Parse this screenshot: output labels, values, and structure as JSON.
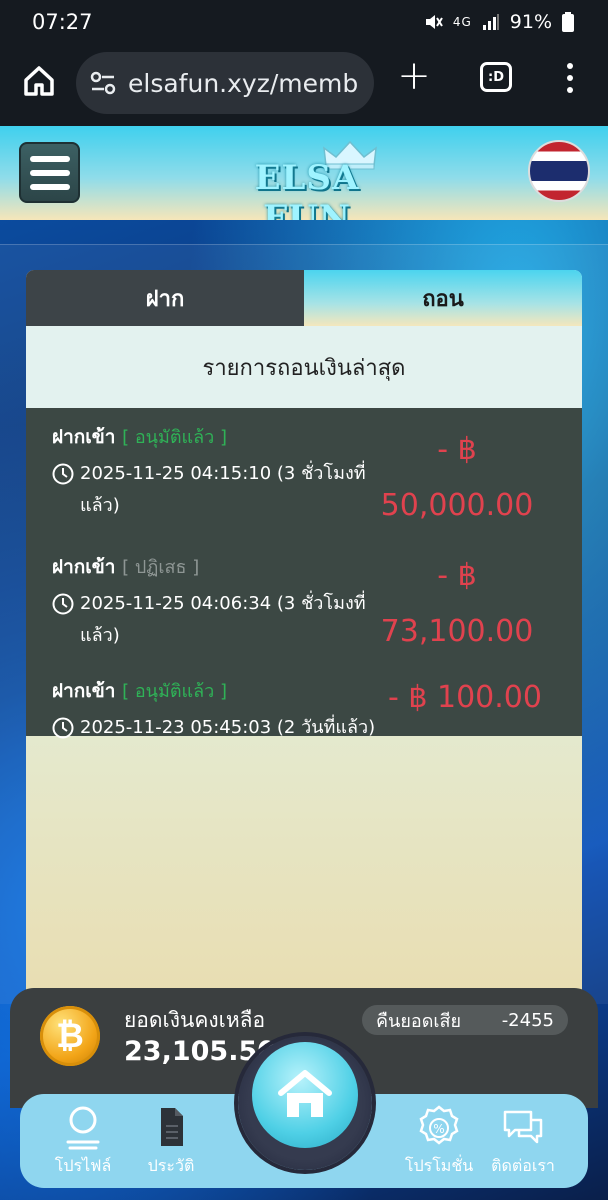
{
  "statusbar": {
    "time": "07:27",
    "network": "4G",
    "battery": "91%"
  },
  "browser": {
    "url": "elsafun.xyz/memb",
    "tabs_label": ":D"
  },
  "header": {
    "logo_text": "ELSA FUN"
  },
  "tabs": [
    {
      "label": "ฝาก",
      "active": true
    },
    {
      "label": "ถอน",
      "active": false
    }
  ],
  "section_title": "รายการถอนเงินล่าสุด",
  "transactions": [
    {
      "type": "ฝากเข้า",
      "status": "[ อนุมัติแล้ว ]",
      "time": "2025-11-25 04:15:10 (3 ชั่วโมงที่แล้ว)",
      "amount": "- ฿ 50,000.00"
    },
    {
      "type": "ฝากเข้า",
      "status": "[ ปฏิเสธ ]",
      "time": "2025-11-25 04:06:34 (3 ชั่วโมงที่แล้ว)",
      "amount": "- ฿ 73,100.00"
    },
    {
      "type": "ฝากเข้า",
      "status": "[ อนุมัติแล้ว ]",
      "time": "2025-11-23 05:45:03 (2 วันที่แล้ว)",
      "amount": "- ฿ 100.00"
    }
  ],
  "wallet": {
    "balance_label": "ยอดเงินคงเหลือ",
    "balance_value": "23,105.50",
    "cashback_label": "คืนยอดเสีย",
    "cashback_value": "-2455"
  },
  "bottom_nav": {
    "profile": "โปรไฟล์",
    "history": "ประวัติ",
    "promotion": "โปรโมชั่น",
    "contact": "ติดต่อเรา"
  },
  "colors": {
    "approved": "#2fb257",
    "rejected": "#8e9694",
    "amount": "#e0424e",
    "tx_bg": "#3c4844"
  }
}
